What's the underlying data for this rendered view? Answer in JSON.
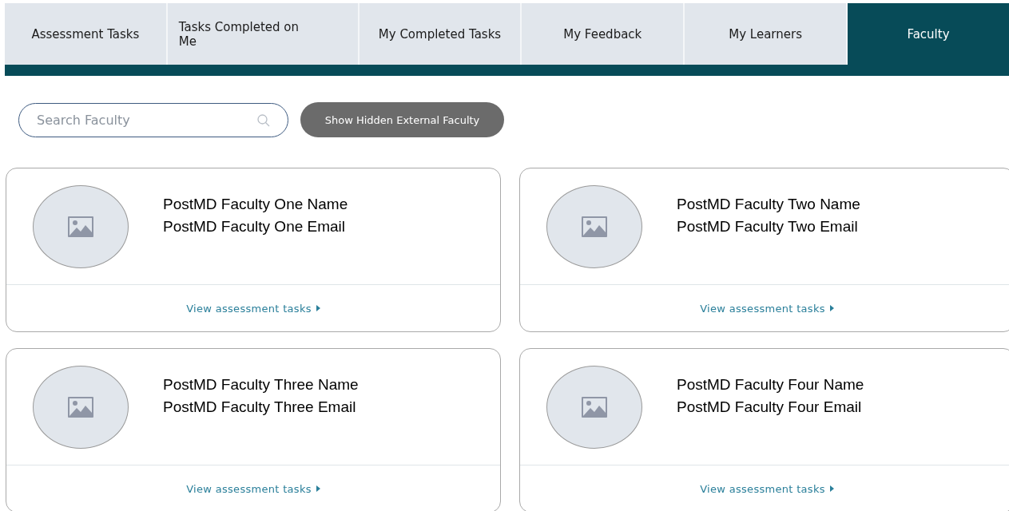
{
  "tabs": [
    {
      "label": "Assessment Tasks",
      "selected": false
    },
    {
      "label": "Tasks Completed on Me",
      "selected": false
    },
    {
      "label": "My Completed Tasks",
      "selected": false
    },
    {
      "label": "My Feedback",
      "selected": false
    },
    {
      "label": "My Learners",
      "selected": false
    },
    {
      "label": "Faculty",
      "selected": true
    }
  ],
  "search": {
    "placeholder": "Search Faculty"
  },
  "toggle_button": "Show Hidden External Faculty",
  "faculty": [
    {
      "name": "PostMD Faculty One Name",
      "email": "PostMD Faculty One Email",
      "link": "View assessment tasks"
    },
    {
      "name": "PostMD Faculty Two Name",
      "email": "PostMD Faculty Two Email",
      "link": "View assessment tasks"
    },
    {
      "name": "PostMD Faculty Three Name",
      "email": "PostMD Faculty Three Email",
      "link": "View assessment tasks"
    },
    {
      "name": "PostMD Faculty Four Name",
      "email": "PostMD Faculty Four Email",
      "link": "View assessment tasks"
    }
  ]
}
